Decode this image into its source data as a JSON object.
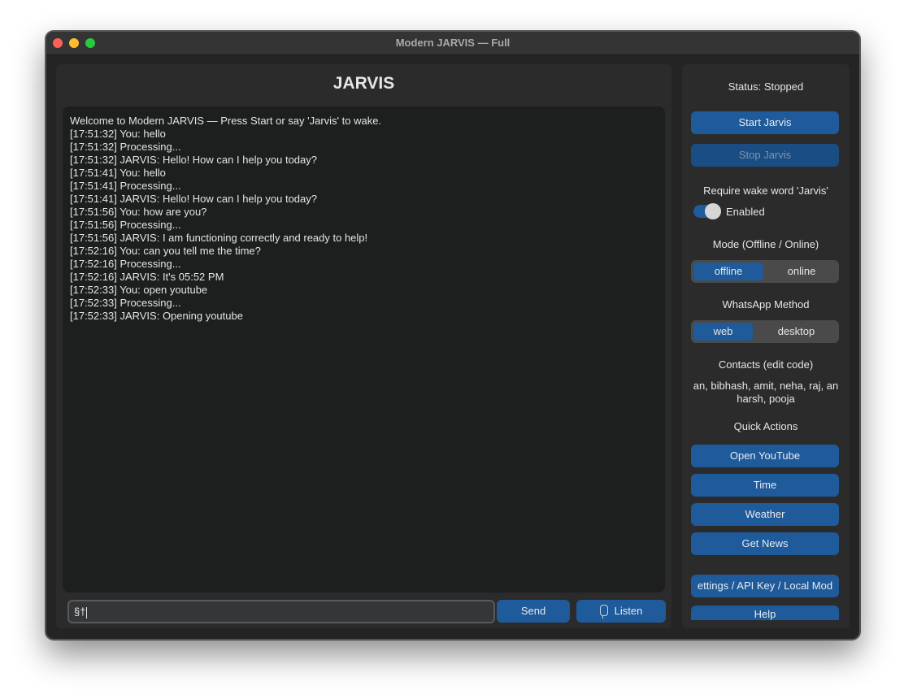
{
  "window": {
    "title": "Modern JARVIS — Full"
  },
  "app": {
    "heading": "JARVIS"
  },
  "chat": {
    "lines": [
      "Welcome to Modern JARVIS — Press Start or say 'Jarvis' to wake.",
      "[17:51:32] You: hello",
      "[17:51:32] Processing...",
      "[17:51:32] JARVIS: Hello! How can I help you today?",
      "[17:51:41] You: hello",
      "[17:51:41] Processing...",
      "[17:51:41] JARVIS: Hello! How can I help you today?",
      "[17:51:56] You: how are you?",
      "[17:51:56] Processing...",
      "[17:51:56] JARVIS: I am functioning correctly and ready to help!",
      "[17:52:16] You: can you tell me the time?",
      "[17:52:16] Processing...",
      "[17:52:16] JARVIS: It's 05:52 PM",
      "[17:52:33] You: open youtube",
      "[17:52:33] Processing...",
      "[17:52:33] JARVIS: Opening youtube"
    ]
  },
  "input": {
    "value": "§†"
  },
  "buttons": {
    "send": "Send",
    "listen": "Listen",
    "listen_icon": "microphone-icon"
  },
  "sidebar": {
    "status": "Status: Stopped",
    "start": "Start Jarvis",
    "stop": "Stop Jarvis",
    "wake_label": "Require wake word 'Jarvis'",
    "wake_toggle": "Enabled",
    "wake_enabled": true,
    "mode_label": "Mode (Offline / Online)",
    "mode_options": [
      "offline",
      "online"
    ],
    "mode_selected": "offline",
    "whatsapp_label": "WhatsApp Method",
    "whatsapp_options": [
      "web",
      "desktop"
    ],
    "whatsapp_selected": "web",
    "contacts_label": "Contacts (edit code)",
    "contacts_line1": "an, bibhash, amit, neha, raj, an",
    "contacts_line2": "harsh, pooja",
    "quick_actions_label": "Quick Actions",
    "quick_actions": [
      "Open YouTube",
      "Time",
      "Weather",
      "Get News"
    ],
    "settings": "ettings / API Key / Local Mod",
    "help": "Help"
  },
  "colors": {
    "accent": "#1f5a9a",
    "window_bg": "#242424",
    "panel_bg": "#2b2b2b",
    "chat_bg": "#1d1e1e"
  }
}
